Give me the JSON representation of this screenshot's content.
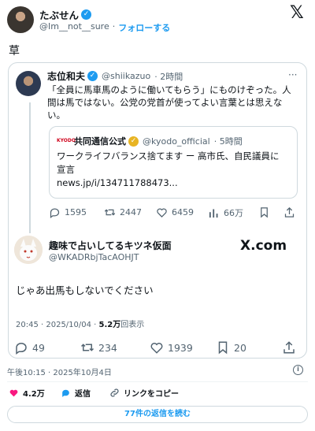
{
  "tweet": {
    "author_name": "たぶせん",
    "author_handle": "@Im__not__sure",
    "separator": "·",
    "follow_label": "フォローする",
    "text": "草",
    "timestamp": "午後10:15 · 2025年10月4日",
    "likes": "4.2万",
    "reply_label": "返信",
    "copy_link_label": "リンクをコピー",
    "read_replies_label": "77件の返信を読む"
  },
  "quoted": {
    "author_name": "志位和夫",
    "author_handle": "@shiikazuo",
    "time": "· 2時間",
    "text": "「全員に馬車馬のように働いてもらう」にものけぞった。人間は馬ではない。公党の党首が使ってよい言葉とは思えない。",
    "more": "···",
    "inner": {
      "logo_text": "KYODO",
      "author_name": "共同通信公式",
      "author_handle": "@kyodo_official",
      "time": "· 5時間",
      "line1": "ワークライフバランス捨てます ー 高市氏、自民議員に",
      "line2": "宣言",
      "link": "news.jp/i/134711788473..."
    },
    "actions": {
      "replies": "1595",
      "retweets": "2447",
      "likes": "6459",
      "views": "66万"
    }
  },
  "reply": {
    "author_name": "趣味で占いしてるキツネ仮面",
    "author_handle": "@WKADRbjTacAOHJT",
    "watermark": "X.com",
    "text": "じゃあ出馬もしないでください",
    "meta_time": "20:45 · 2025/10/04 · ",
    "meta_views": "5.2万",
    "meta_views_label": "回表示",
    "actions": {
      "replies": "49",
      "retweets": "234",
      "likes": "1939",
      "bookmarks": "20"
    }
  },
  "colors": {
    "accent": "#1d9bf0",
    "like": "#f91880",
    "muted": "#536471",
    "gold_verified": "#e8b423"
  }
}
